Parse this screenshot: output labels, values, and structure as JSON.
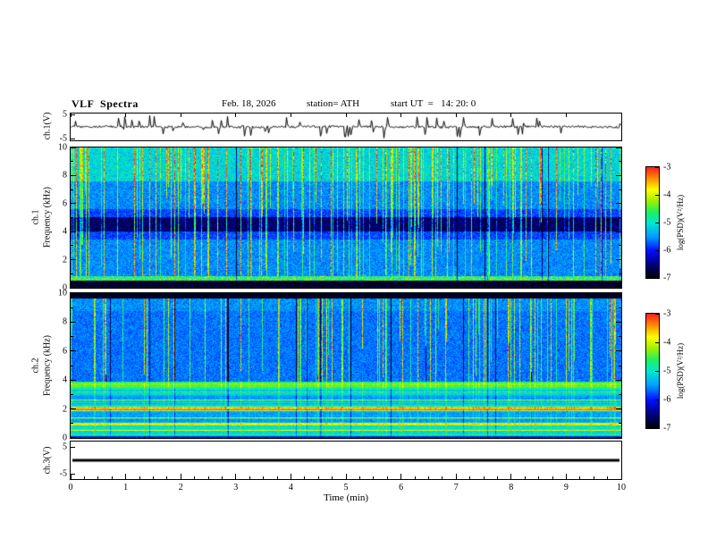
{
  "figure": {
    "title": "VLF  Spectra",
    "date": "Feb. 18, 2026",
    "station": "station= ATH",
    "start_ut": "start UT  =   14: 20: 0"
  },
  "xaxis": {
    "label": "Time (min)",
    "min": 0,
    "max": 10,
    "ticks": [
      "0",
      "1",
      "2",
      "3",
      "4",
      "5",
      "6",
      "7",
      "8",
      "9",
      "10"
    ]
  },
  "colorbar": {
    "label": "log(PSD)(V²/Hz)",
    "ticks": [
      "-3",
      "-4",
      "-5",
      "-6",
      "-7"
    ],
    "zlim": [
      -7,
      -3
    ],
    "colormap_stops": [
      [
        0.0,
        "#000000"
      ],
      [
        0.14,
        "#000090"
      ],
      [
        0.25,
        "#0010ff"
      ],
      [
        0.38,
        "#00a0ff"
      ],
      [
        0.5,
        "#00e8d0"
      ],
      [
        0.6,
        "#20f060"
      ],
      [
        0.7,
        "#a0f000"
      ],
      [
        0.8,
        "#ffff00"
      ],
      [
        0.9,
        "#ff9000"
      ],
      [
        1.0,
        "#ff2020"
      ]
    ]
  },
  "chart_data": [
    {
      "id": "ch1_wave",
      "type": "line",
      "ylabel": "ch.1(V)",
      "ylim": [
        -5,
        5
      ],
      "ytick_labels": [
        "5",
        "-5"
      ],
      "xlim": [
        0,
        10
      ],
      "description": "Broadband noisy voltage trace centered on 0 V with many impulsive sferic spikes up to about ±4 V over the 10-minute record",
      "gen": {
        "seed": 1101,
        "noise_amp": 0.8,
        "spike_count": 55,
        "spike_amp_min": 0.8,
        "spike_amp_max": 4.0
      }
    },
    {
      "id": "ch1_spec",
      "type": "heatmap",
      "ylabel_line1": "ch.1",
      "ylabel_line2": "Frequency (kHz)",
      "ylim": [
        0,
        10
      ],
      "ytick_labels": [
        "10",
        "8",
        "6",
        "4",
        "2",
        "0"
      ],
      "xlim": [
        0,
        10
      ],
      "zlim": [
        -7,
        -3
      ],
      "description": "VLF spectrogram of ch.1: blue broadband background densely crossed by vertical green/yellow sferic streaks, dark absorption band near 4-5 kHz, enhanced speckle above 8 kHz, black band below ~0.5 kHz with a bright row just above it",
      "gen": {
        "seed": 2202,
        "streak_density": 0.2,
        "dark_density": 0.012,
        "dark_band_lo": 4.05,
        "dark_band_hi": 5.05,
        "black_below": 0.55
      }
    },
    {
      "id": "ch2_spec",
      "type": "heatmap",
      "ylabel_line1": "ch.2",
      "ylabel_line2": "Frequency (kHz)",
      "ylim": [
        0,
        10
      ],
      "ytick_labels": [
        "10",
        "8",
        "6",
        "4",
        "2",
        "0"
      ],
      "xlim": [
        0,
        10
      ],
      "zlim": [
        -7,
        -3
      ],
      "description": "VLF spectrogram of ch.2: black band at the very top (~10 kHz), blue background with vertical sferic streaks above ~4 kHz, strong horizontal green/yellow interference striations below ~4 kHz with bright lines near 2.1, 1.0 and 0.55 kHz",
      "gen": {
        "seed": 3303,
        "streak_density": 0.13,
        "dark_density": 0.03,
        "black_above": 9.65,
        "striation_below": 3.9,
        "lines": [
          {
            "f": 2.1,
            "v": 0.9,
            "w": 1
          },
          {
            "f": 1.9,
            "v": 0.8,
            "w": 0
          },
          {
            "f": 1.0,
            "v": 0.82,
            "w": 1
          },
          {
            "f": 0.55,
            "v": 0.78,
            "w": 0
          },
          {
            "f": 1.45,
            "v": 0.74,
            "w": 0
          },
          {
            "f": 2.65,
            "v": 0.7,
            "w": 0
          },
          {
            "f": 3.2,
            "v": 0.62,
            "w": 0
          },
          {
            "f": 3.65,
            "v": 0.6,
            "w": 0
          }
        ]
      }
    },
    {
      "id": "ch3_wave",
      "type": "line",
      "ylabel": "ch.3(V)",
      "ylim": [
        -7,
        7
      ],
      "ytick_labels": [
        "5",
        "-5"
      ],
      "xlim": [
        0,
        10
      ],
      "description": "Flat thick black trace at 0 V for the whole record (channel inactive)",
      "gen": {
        "flat": true
      }
    }
  ]
}
